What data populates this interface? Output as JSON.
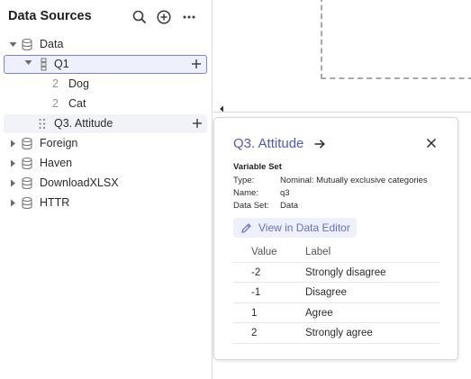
{
  "sidebar": {
    "title": "Data Sources",
    "icons": {
      "search": "search-icon",
      "add": "add-circle-icon",
      "more": "more-icon"
    },
    "tree": {
      "data": {
        "label": "Data",
        "expanded": true
      },
      "q1": {
        "label": "Q1",
        "expanded": true,
        "selected": true
      },
      "dog": {
        "num": "2",
        "label": "Dog"
      },
      "cat": {
        "num": "2",
        "label": "Cat"
      },
      "q3": {
        "label": "Q3. Attitude",
        "hovered": true
      },
      "foreign": {
        "label": "Foreign"
      },
      "haven": {
        "label": "Haven"
      },
      "download": {
        "label": "DownloadXLSX"
      },
      "httr": {
        "label": "HTTR"
      }
    }
  },
  "popover": {
    "title": "Q3. Attitude",
    "subhead": "Variable Set",
    "meta": {
      "type_key": "Type:",
      "type_val": "Nominal: Mutually exclusive categories",
      "name_key": "Name:",
      "name_val": "q3",
      "dataset_key": "Data Set:",
      "dataset_val": "Data"
    },
    "view_button": "View in Data Editor",
    "table": {
      "headers": {
        "value": "Value",
        "label": "Label"
      },
      "rows": [
        {
          "value": "-2",
          "label": "Strongly disagree"
        },
        {
          "value": "-1",
          "label": "Disagree"
        },
        {
          "value": "1",
          "label": "Agree"
        },
        {
          "value": "2",
          "label": "Strongly agree"
        }
      ]
    }
  },
  "colors": {
    "accent": "#4d58c7",
    "selection_border": "#7b84d4",
    "selection_bg": "#eef1fb"
  }
}
